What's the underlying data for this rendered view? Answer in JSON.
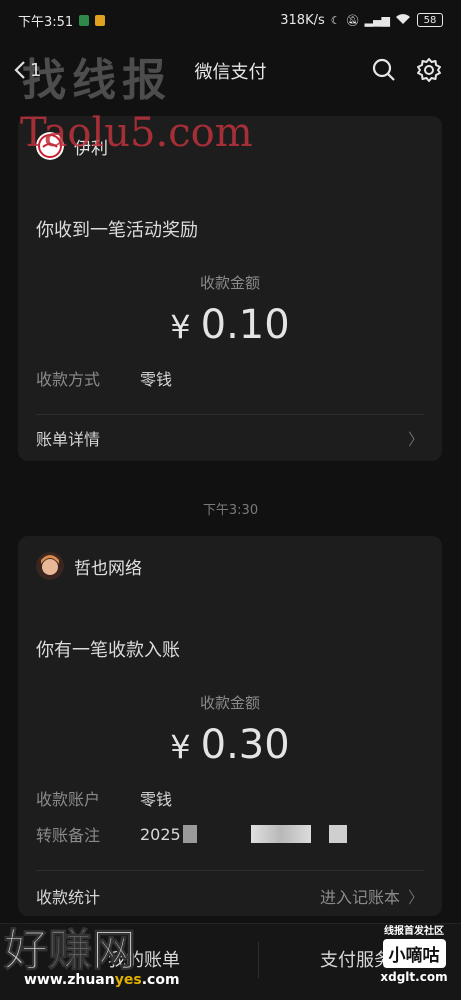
{
  "status_bar": {
    "time": "下午3:51",
    "speed": "318K/s",
    "battery": "58"
  },
  "nav": {
    "back_count": "1",
    "title": "微信支付"
  },
  "watermarks": {
    "top_cn": "找线报",
    "top_en": "Taolu5.com",
    "bottom_cn": "好赚网",
    "bottom_url_a": "www.zhuan",
    "bottom_url_b": "yes",
    "bottom_url_c": ".com",
    "badge_top": "线报首发社区",
    "badge_main": "小嘀咕",
    "badge_url": "xdglt.com"
  },
  "messages": [
    {
      "merchant": "伊利",
      "title": "你收到一笔活动奖励",
      "amount_label": "收款金额",
      "currency": "¥",
      "amount": "0.10",
      "rows": [
        {
          "key": "收款方式",
          "value": "零钱"
        }
      ],
      "footer_label": "账单详情",
      "footer_action": ""
    },
    {
      "merchant": "哲也网络",
      "title": "你有一笔收款入账",
      "amount_label": "收款金额",
      "currency": "¥",
      "amount": "0.30",
      "rows": [
        {
          "key": "收款账户",
          "value": "零钱"
        },
        {
          "key": "转账备注",
          "value": "2025"
        }
      ],
      "footer_label": "收款统计",
      "footer_action": "进入记账本"
    }
  ],
  "timestamp": "下午3:30",
  "bottom_tabs": {
    "left": "我的账单",
    "right": "支付服务"
  },
  "colors": {
    "background": "#111111",
    "card": "#1d1d1d",
    "avatar1": "#c8202e",
    "avatar2": "#d98a4a"
  },
  "icons": [
    "back-icon",
    "search-icon",
    "settings-gear-icon",
    "chevron-right-icon"
  ]
}
